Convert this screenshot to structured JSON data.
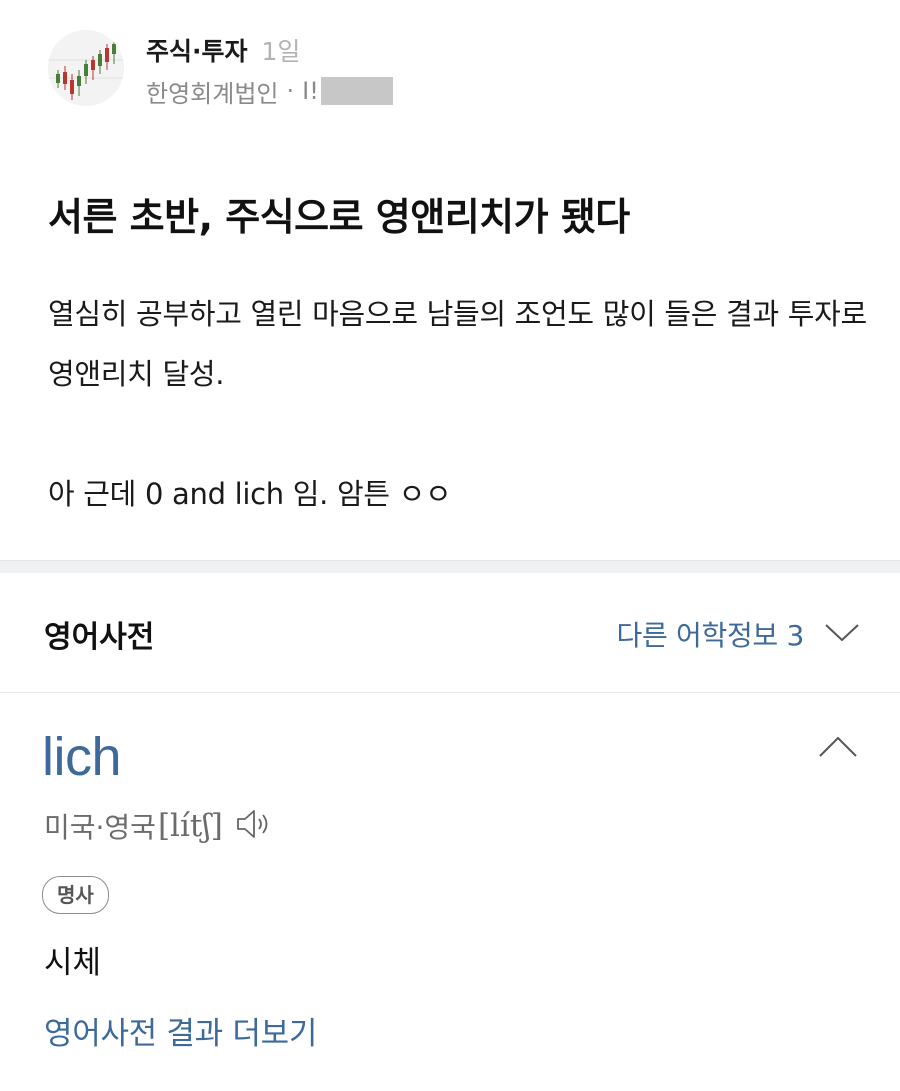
{
  "post": {
    "board_name": "주식·투자",
    "time_ago": "1일",
    "author_company": "한영회계법인",
    "author_separator": "·",
    "author_nick_visible": "I!",
    "title": "서른 초반, 주식으로 영앤리치가 됐다",
    "body_paragraph_1": "열심히 공부하고 열린 마음으로 남들의 조언도 많이 들은 결과 투자로 영앤리치 달성.",
    "body_paragraph_2": "아 근데 0 and lich 임. 암튼 ㅇㅇ"
  },
  "dictionary": {
    "section_title": "영어사전",
    "other_info_label": "다른 어학정보 3",
    "entry": {
      "word": "lich",
      "pron_region": "미국·영국",
      "pron_ipa": "[lítʃ]",
      "part_of_speech": "명사",
      "meaning": "시체"
    },
    "more_results_label": "영어사전 결과 더보기"
  },
  "colors": {
    "accent_link": "#3d6a9a",
    "muted_text": "#8a8a8a",
    "redaction": "#c7c7c7"
  },
  "icons": {
    "avatar": "stock-chart-avatar",
    "other_info_toggle": "chevron-down-icon",
    "entry_toggle": "chevron-up-icon",
    "pronunciation": "speaker-icon"
  }
}
